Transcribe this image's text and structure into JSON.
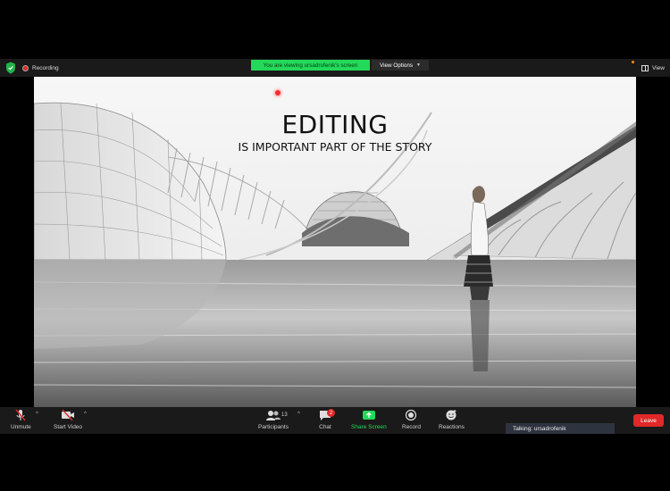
{
  "topbar": {
    "recording_label": "Recording",
    "viewing_banner": "You are viewing ursadrofenik's screen",
    "view_options_label": "View Options",
    "view_label": "View",
    "colors": {
      "banner": "#23d959",
      "recording_dot": "#e02828",
      "notify_dot": "#f28c1c"
    }
  },
  "slide": {
    "title": "EDITING",
    "subtitle": "IS IMPORTANT PART OF THE STORY"
  },
  "toolbar": {
    "unmute_label": "Unmute",
    "start_video_label": "Start Video",
    "participants_label": "Participants",
    "participants_count": "13",
    "chat_label": "Chat",
    "chat_badge": "2",
    "share_screen_label": "Share Screen",
    "record_label": "Record",
    "reactions_label": "Reactions",
    "leave_label": "Leave",
    "colors": {
      "share": "#23d959",
      "leave": "#e02828"
    }
  },
  "talking_indicator": "Talking: ursadrofenik",
  "icons": [
    "shield-icon",
    "record-dot-icon",
    "chevron-down-icon",
    "gallery-view-icon",
    "microphone-muted-icon",
    "video-off-icon",
    "participants-icon",
    "chat-icon",
    "share-screen-icon",
    "record-icon",
    "reactions-icon",
    "caret-up-icon"
  ]
}
